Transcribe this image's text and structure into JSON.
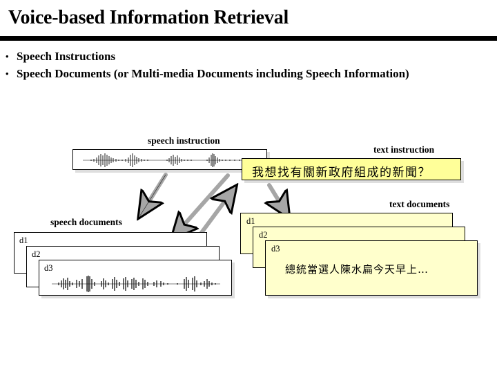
{
  "slide": {
    "title": "Voice-based Information Retrieval",
    "bullets": [
      {
        "mark": "•",
        "text": "Speech Instructions"
      },
      {
        "mark": "•",
        "text": "Speech Documents (or Multi-media Documents including Speech Information)"
      }
    ]
  },
  "diagram": {
    "speech_instruction": {
      "caption": "speech instruction"
    },
    "text_instruction": {
      "caption": "text instruction",
      "content": "我想找有關新政府組成的新聞？"
    },
    "speech_documents": {
      "caption": "speech documents",
      "labels": [
        "d1",
        "d2",
        "d3"
      ]
    },
    "text_documents": {
      "caption": "text documents",
      "labels": [
        "d1",
        "d2",
        "d3"
      ],
      "content": "總統當選人陳水扁今天早上…"
    },
    "colors": {
      "instruction_fill": "#ffff99",
      "document_fill": "#ffffcc",
      "box_border": "#000000",
      "arrow_fill": "#a6a6a6",
      "arrow_stroke": "#000000",
      "rule": "#000000"
    }
  }
}
